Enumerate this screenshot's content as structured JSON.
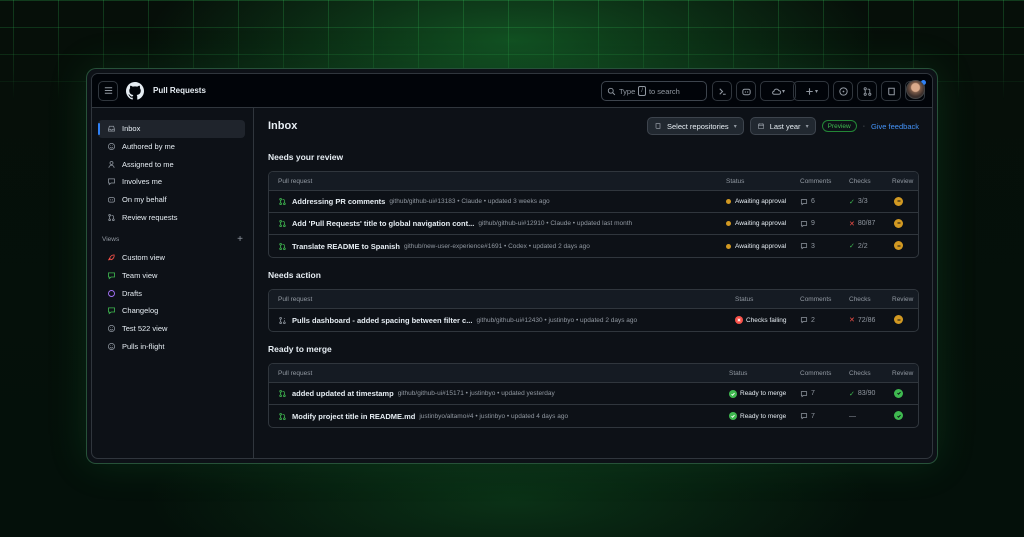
{
  "header": {
    "app_title": "Pull Requests",
    "search_placeholder_pre": "Type",
    "search_key": "/",
    "search_placeholder_post": "to search"
  },
  "sidebar": {
    "items": [
      {
        "label": "Inbox",
        "icon": "inbox-icon",
        "active": true
      },
      {
        "label": "Authored by me",
        "icon": "smiley-icon"
      },
      {
        "label": "Assigned to me",
        "icon": "person-icon"
      },
      {
        "label": "Involves me",
        "icon": "comment-icon"
      },
      {
        "label": "On my behalf",
        "icon": "copilot-icon"
      },
      {
        "label": "Review requests",
        "icon": "git-pull-request-icon"
      }
    ],
    "views_label": "Views",
    "views_add": "+",
    "views": [
      {
        "label": "Custom view",
        "icon": "rocket-icon",
        "color": "#f85149"
      },
      {
        "label": "Team view",
        "icon": "comment-icon",
        "color": "#3fb950"
      },
      {
        "label": "Drafts",
        "icon": "circle-icon",
        "color": "#a371f7"
      },
      {
        "label": "Changelog",
        "icon": "comment-icon",
        "color": "#3fb950"
      },
      {
        "label": "Test 522 view",
        "icon": "smiley-icon",
        "color": "#9198a1"
      },
      {
        "label": "Pulls in-flight",
        "icon": "smiley-icon",
        "color": "#9198a1"
      }
    ]
  },
  "main": {
    "title": "Inbox",
    "select_repos": "Select repositories",
    "date_range": "Last year",
    "preview_badge": "Preview",
    "feedback_link": "Give feedback",
    "columns": {
      "pr": "Pull request",
      "status": "Status",
      "comments": "Comments",
      "checks": "Checks",
      "review": "Review"
    },
    "sections": [
      {
        "title": "Needs your review",
        "rows": [
          {
            "title": "Addressing PR comments",
            "meta": "github/github-ui#13183 • Claude • updated 3 weeks ago",
            "pr_icon": "git-pull-request-icon",
            "status": "Awaiting approval",
            "status_kind": "awaiting",
            "comments": "6",
            "checks": "3/3",
            "checks_kind": "pass",
            "review": "pending"
          },
          {
            "title": "Add 'Pull Requests' title to global navigation cont...",
            "meta": "github/github-ui#12910 • Claude • updated last month",
            "pr_icon": "git-pull-request-icon",
            "status": "Awaiting approval",
            "status_kind": "awaiting",
            "comments": "9",
            "checks": "80/87",
            "checks_kind": "fail",
            "review": "pending"
          },
          {
            "title": "Translate README to Spanish",
            "meta": "github/new-user-experience#1691 • Codex • updated 2 days ago",
            "pr_icon": "git-pull-request-icon",
            "status": "Awaiting approval",
            "status_kind": "awaiting",
            "comments": "3",
            "checks": "2/2",
            "checks_kind": "pass",
            "review": "pending"
          }
        ]
      },
      {
        "title": "Needs action",
        "rows": [
          {
            "title": "Pulls dashboard - added spacing between filter c...",
            "meta": "github/github-ui#12430 • justinbyo • updated 2 days ago",
            "pr_icon": "git-pull-request-draft-icon",
            "status": "Checks failing",
            "status_kind": "failing",
            "comments": "2",
            "checks": "72/86",
            "checks_kind": "fail",
            "review": "pending"
          }
        ]
      },
      {
        "title": "Ready to merge",
        "rows": [
          {
            "title": "added updated at timestamp",
            "meta": "github/github-ui#15171 • justinbyo • updated yesterday",
            "pr_icon": "git-pull-request-icon",
            "status": "Ready to merge",
            "status_kind": "ready",
            "comments": "7",
            "checks": "83/90",
            "checks_kind": "pass",
            "review": "approved"
          },
          {
            "title": "Modify project title in README.md",
            "meta": "justinbyo/altamo#4 • justinbyo • updated 4 days ago",
            "pr_icon": "git-pull-request-icon",
            "status": "Ready to merge",
            "status_kind": "ready",
            "comments": "7",
            "checks": "—",
            "checks_kind": "none",
            "review": "approved"
          }
        ]
      }
    ]
  },
  "colors": {
    "accent": "#2f81f7",
    "success": "#3fb950",
    "danger": "#f85149",
    "attention": "#d29922",
    "review_pending": "#d29922"
  }
}
